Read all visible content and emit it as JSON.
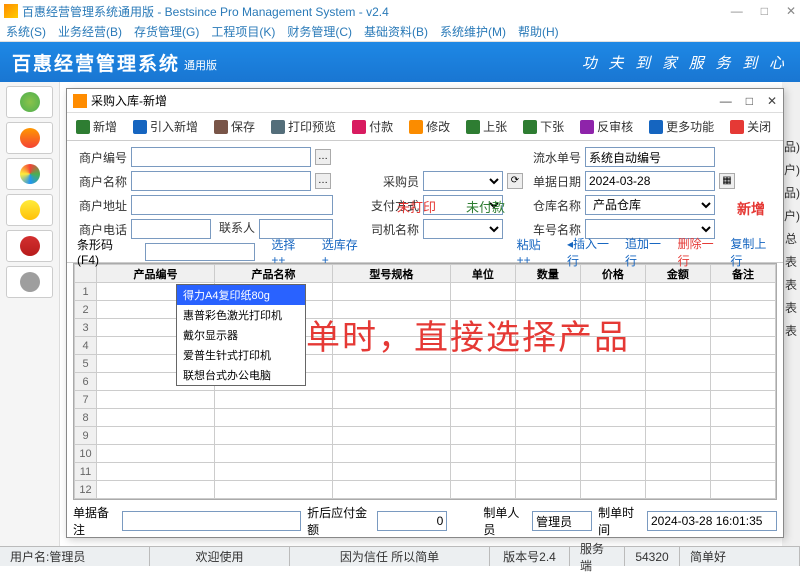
{
  "window": {
    "title": "百惠经营管理系统通用版 - Bestsince Pro Management System - v2.4"
  },
  "menu": [
    "系统(S)",
    "业务经营(B)",
    "存货管理(G)",
    "工程项目(K)",
    "财务管理(C)",
    "基础资料(B)",
    "系统维护(M)",
    "帮助(H)"
  ],
  "banner": {
    "title": "百惠经营管理系统",
    "sub": "通用版",
    "slogan": "功 夫 到 家  服 务 到 心"
  },
  "dialog": {
    "title": "采购入库-新增"
  },
  "toolbar": [
    {
      "label": "新增",
      "color": "#2e7d32"
    },
    {
      "label": "引入新增",
      "color": "#1565c0"
    },
    {
      "label": "保存",
      "color": "#795548"
    },
    {
      "label": "打印预览",
      "color": "#546e7a"
    },
    {
      "label": "付款",
      "color": "#d81b60"
    },
    {
      "label": "修改",
      "color": "#fb8c00"
    },
    {
      "label": "上张",
      "color": "#2e7d32"
    },
    {
      "label": "下张",
      "color": "#2e7d32"
    },
    {
      "label": "反审核",
      "color": "#8e24aa"
    },
    {
      "label": "更多功能",
      "color": "#1565c0"
    },
    {
      "label": "关闭",
      "color": "#e53935"
    }
  ],
  "fields": {
    "merchant_no": "商户编号",
    "merchant_name": "商户名称",
    "merchant_addr": "商户地址",
    "merchant_tel": "商户电话",
    "contact": "联系人",
    "barcode": "条形码(F4)",
    "unprinted": "未打印",
    "unpaid": "未付款",
    "buyer": "采购员",
    "pay_method": "支付方式",
    "driver": "司机名称",
    "serial": "流水单号",
    "serial_val": "系统自动编号",
    "bill_date": "单据日期",
    "bill_date_val": "2024-03-28",
    "warehouse": "仓库名称",
    "warehouse_val": "产品仓库",
    "car": "车号名称",
    "new": "新增"
  },
  "ops": {
    "select": "选择++",
    "sel_stock": "选库存+",
    "paste": "粘贴++",
    "insert": "◂插入一行",
    "append": "追加一行",
    "delete": "删除一行",
    "copy_up": "复制上行"
  },
  "grid_headers": [
    "产品编号",
    "产品名称",
    "型号规格",
    "单位",
    "数量",
    "价格",
    "金额",
    "备注"
  ],
  "dropdown": [
    "得力A4复印纸80g",
    "惠普彩色激光打印机",
    "戴尔显示器",
    "爱普生针式打印机",
    "联想台式办公电脑"
  ],
  "big_text": "开单时，直接选择产品",
  "footer": {
    "remark": "单据备注",
    "discount_amt": "折后应付金额",
    "discount_val": "0",
    "maker": "制单人员",
    "maker_val": "管理员",
    "make_time": "制单时间",
    "make_time_val": "2024-03-28 16:01:35"
  },
  "statusbar": {
    "user": "用户名:管理员",
    "welcome": "欢迎使用",
    "motto": "因为信任 所以简单",
    "ver": "版本号2.4",
    "server": "服务端",
    "num": "54320",
    "simple": "简单好"
  }
}
